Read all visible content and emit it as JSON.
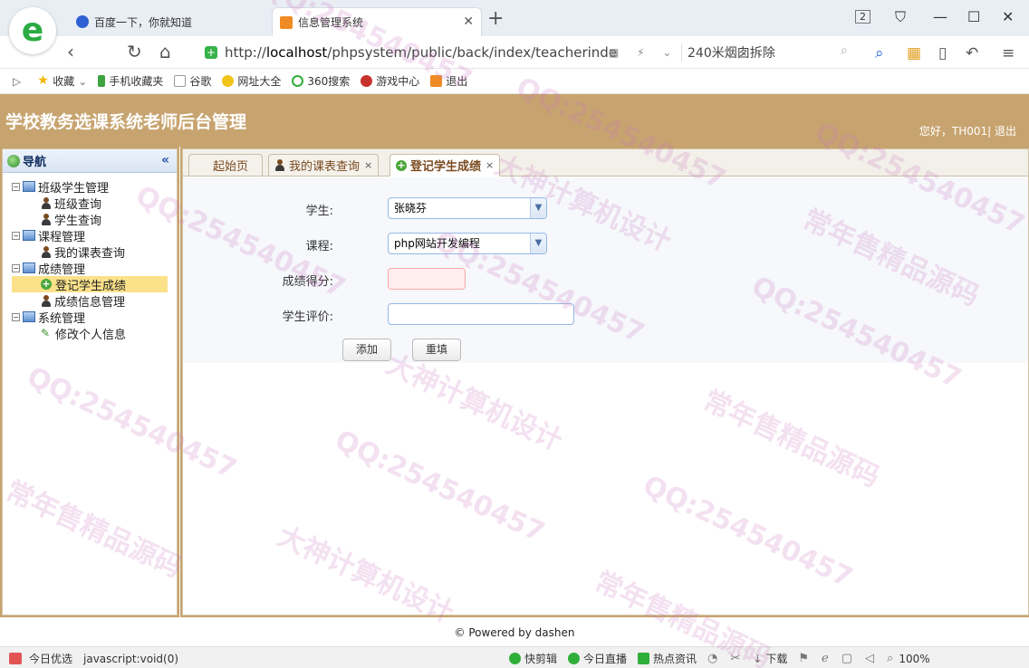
{
  "browser": {
    "tabs": [
      {
        "title": "百度一下，你就知道",
        "active": false
      },
      {
        "title": "信息管理系统",
        "active": true
      }
    ],
    "tab_count": "2",
    "url_prefix": "http://",
    "url_host": "localhost",
    "url_path": "/phpsystem/public/back/index/teacherinde",
    "side_search": "240米烟囱拆除",
    "bookmarks": [
      "收藏",
      "手机收藏夹",
      "谷歌",
      "网址大全",
      "360搜索",
      "游戏中心",
      "退出"
    ]
  },
  "app": {
    "title": "学校教务选课系统老师后台管理",
    "greeting": "您好，TH001| 退出"
  },
  "nav": {
    "title": "导航",
    "groups": [
      {
        "label": "班级学生管理",
        "items": [
          {
            "label": "班级查询",
            "icon": "person-icon"
          },
          {
            "label": "学生查询",
            "icon": "person-icon"
          }
        ]
      },
      {
        "label": "课程管理",
        "items": [
          {
            "label": "我的课表查询",
            "icon": "person-icon"
          }
        ]
      },
      {
        "label": "成绩管理",
        "items": [
          {
            "label": "登记学生成绩",
            "icon": "add-icon",
            "selected": true
          },
          {
            "label": "成绩信息管理",
            "icon": "person-icon"
          }
        ]
      },
      {
        "label": "系统管理",
        "items": [
          {
            "label": "修改个人信息",
            "icon": "pencil-icon"
          }
        ]
      }
    ]
  },
  "tabs": [
    {
      "label": "起始页",
      "closable": false
    },
    {
      "label": "我的课表查询",
      "closable": true
    },
    {
      "label": "登记学生成绩",
      "closable": true,
      "active": true
    }
  ],
  "form": {
    "student_label": "学生:",
    "student_value": "张晓芬",
    "course_label": "课程:",
    "course_value": "php网站开发编程",
    "score_label": "成绩得分:",
    "score_value": "",
    "comment_label": "学生评价:",
    "comment_value": "",
    "add_button": "添加",
    "reset_button": "重填"
  },
  "footer": "© Powered by dashen",
  "status": {
    "left_label": "今日优选",
    "link_text": "javascript:void(0)",
    "items": [
      "快剪辑",
      "今日直播",
      "热点资讯"
    ],
    "download": "下载",
    "zoom": "100%"
  },
  "watermark": {
    "qq": "QQ:254540457",
    "text1": "大神计算机设计",
    "text2": "常年售精品源码"
  }
}
